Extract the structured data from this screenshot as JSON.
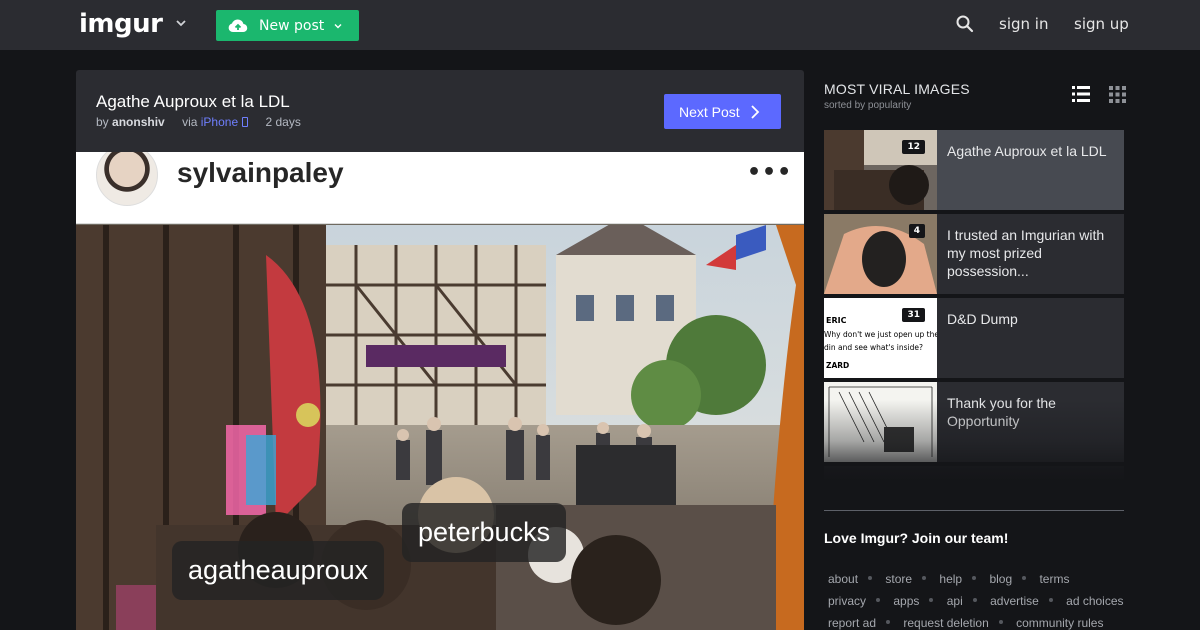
{
  "topbar": {
    "logo": "imgur",
    "new_post_label": "New post",
    "sign_in": "sign in",
    "sign_up": "sign up"
  },
  "post": {
    "title": "Agathe Auproux et la LDL",
    "by_prefix": "by",
    "author": "anonshiv",
    "via_prefix": "via",
    "via_device": "iPhone",
    "age": "2 days",
    "next_post_label": "Next Post",
    "image": {
      "instagram_username": "sylvainpaley",
      "more_glyph": "•••",
      "tags": [
        "peterbucks",
        "agatheauproux"
      ]
    }
  },
  "sidebar": {
    "title": "MOST VIRAL IMAGES",
    "subtitle": "sorted by popularity",
    "items": [
      {
        "title": "Agathe Auproux et la LDL",
        "count": "12",
        "active": true
      },
      {
        "title": "I trusted an Imgurian with my most prized possession...",
        "count": "4"
      },
      {
        "title": "D&D Dump",
        "count": "31",
        "thumb_lines": [
          "ERIC",
          "Why don't we just open up the",
          "din and see what's inside?",
          "ZARD"
        ]
      },
      {
        "title": "Thank you for the Opportunity",
        "count": ""
      }
    ],
    "join": "Love Imgur? Join our team!",
    "footer_rows": [
      [
        "about",
        "store",
        "help",
        "blog",
        "terms"
      ],
      [
        "privacy",
        "apps",
        "api",
        "advertise",
        "ad choices"
      ],
      [
        "report ad",
        "request deletion",
        "community rules"
      ]
    ]
  },
  "colors": {
    "page_bg": "#141518",
    "bar_bg": "#2b2c31",
    "new_post_green": "#1bb76e",
    "next_post_blue": "#5c69ff",
    "link_blue": "#6f7ffe"
  },
  "icons": [
    "upload-cloud-icon",
    "chevron-down-icon",
    "search-icon",
    "phone-icon",
    "chevron-right-icon",
    "list-view-icon",
    "grid-view-icon"
  ]
}
